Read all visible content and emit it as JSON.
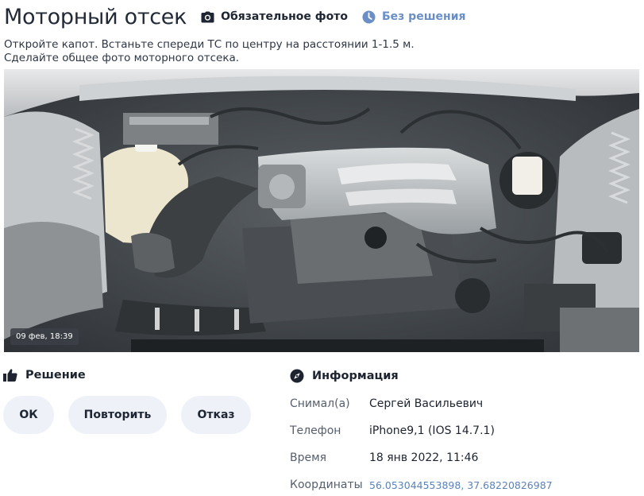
{
  "header": {
    "title": "Моторный отсек",
    "requirement": "Обязательное фото",
    "status": "Без решения"
  },
  "instructions": {
    "line1": "Откройте капот. Встаньте спереди ТС по центру на расстоянии 1-1.5 м.",
    "line2": "Сделайте общее фото моторного отсека."
  },
  "photo": {
    "timestamp": "09 фев, 18:39"
  },
  "decision": {
    "title": "Решение",
    "buttons": {
      "ok": "ОК",
      "repeat": "Повторить",
      "reject": "Отказ"
    }
  },
  "info": {
    "title": "Информация",
    "rows": [
      {
        "label": "Снимал(а)",
        "value": "Сергей Васильевич"
      },
      {
        "label": "Телефон",
        "value": "iPhone9,1 (IOS 14.7.1)"
      },
      {
        "label": "Время",
        "value": "18 янв 2022, 11:46"
      },
      {
        "label": "Координаты",
        "value": "56.053044553898, 37.68220826987"
      }
    ]
  },
  "colors": {
    "status": "#6a8fc7",
    "button_bg": "#eef2f8",
    "link": "#5b82b9"
  }
}
